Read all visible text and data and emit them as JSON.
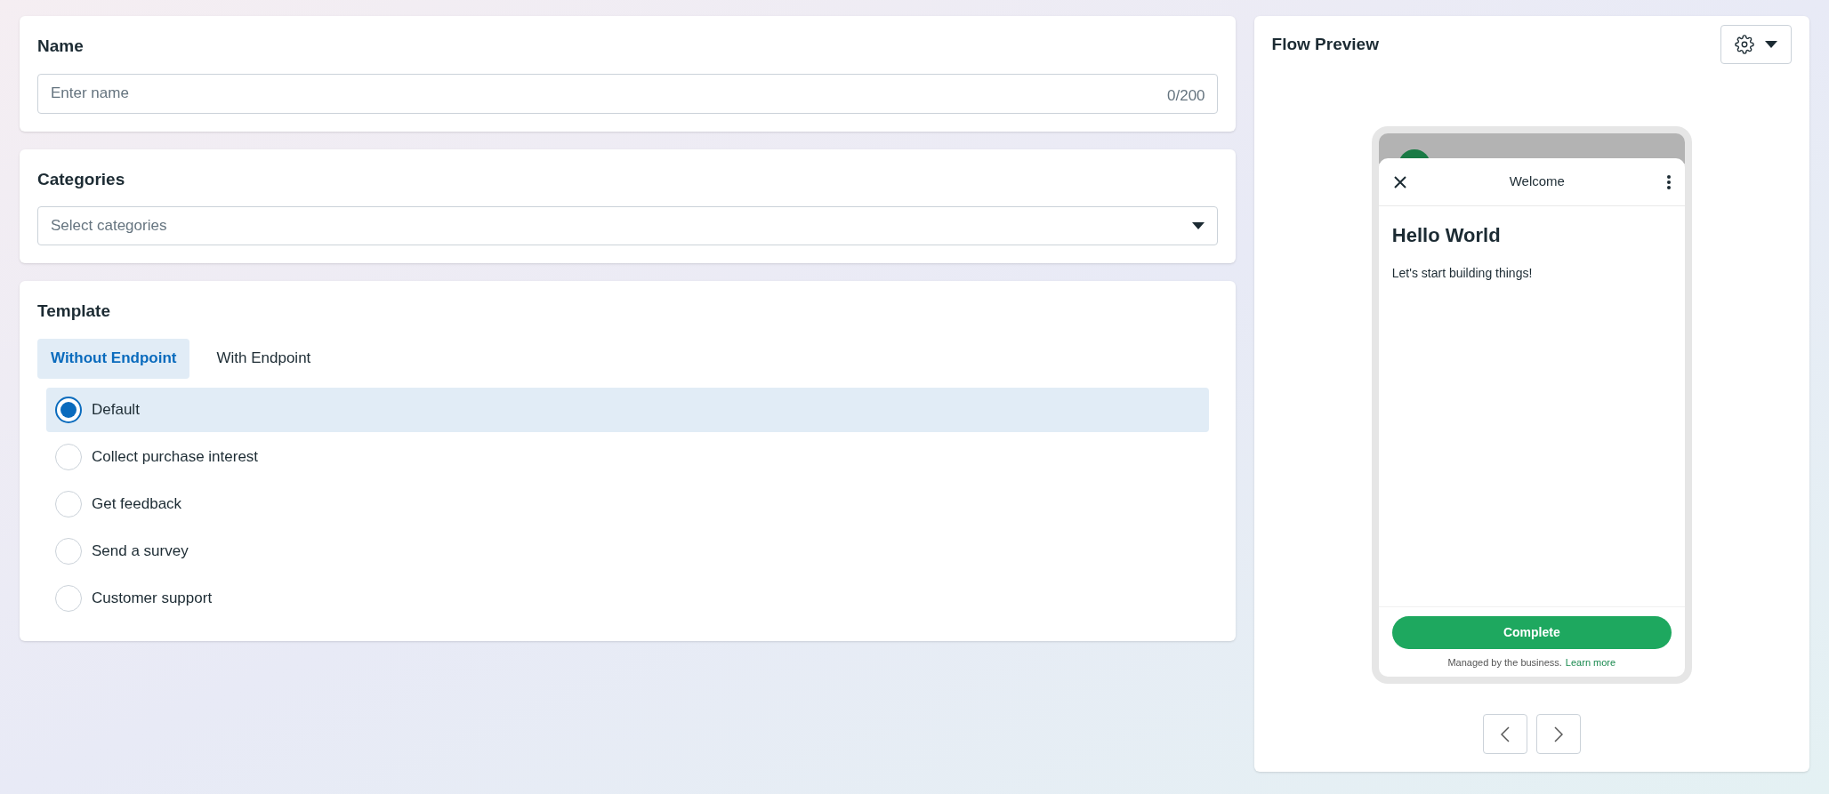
{
  "name_section": {
    "title": "Name",
    "placeholder": "Enter name",
    "counter": "0/200"
  },
  "categories_section": {
    "title": "Categories",
    "placeholder": "Select categories"
  },
  "template_section": {
    "title": "Template",
    "tabs": [
      {
        "label": "Without Endpoint",
        "selected": true
      },
      {
        "label": "With Endpoint",
        "selected": false
      }
    ],
    "options": [
      {
        "label": "Default",
        "selected": true
      },
      {
        "label": "Collect purchase interest",
        "selected": false
      },
      {
        "label": "Get feedback",
        "selected": false
      },
      {
        "label": "Send a survey",
        "selected": false
      },
      {
        "label": "Customer support",
        "selected": false
      }
    ]
  },
  "preview": {
    "title": "Flow Preview",
    "phone": {
      "screen_title": "Welcome",
      "heading": "Hello World",
      "body": "Let's start building things!",
      "button": "Complete",
      "footer": "Managed by the business.",
      "footer_link": "Learn more"
    }
  }
}
